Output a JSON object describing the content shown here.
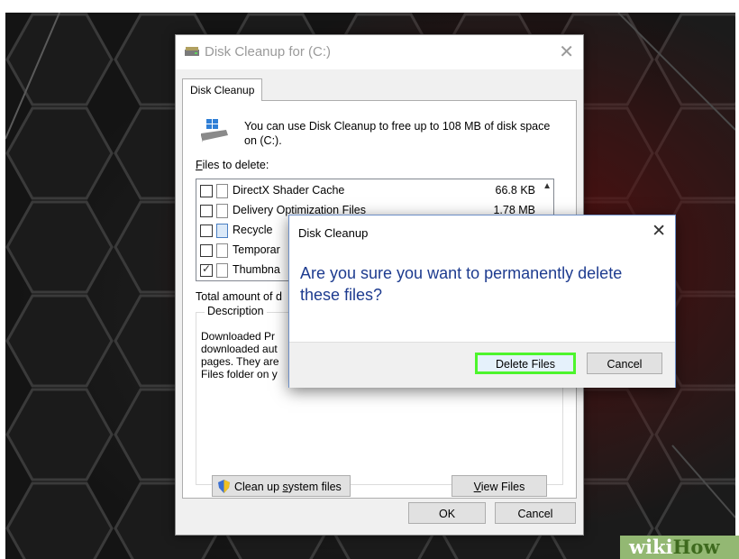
{
  "window": {
    "title": "Disk Cleanup for  (C:)",
    "tab_label": "Disk Cleanup",
    "intro_text": "You can use Disk Cleanup to free up to 108 MB of disk space on  (C:).",
    "files_label_prefix": "F",
    "files_label_rest": "iles to delete:",
    "files": [
      {
        "name": "DirectX Shader Cache",
        "size": "66.8 KB",
        "checked": false
      },
      {
        "name": "Delivery Optimization Files",
        "size": "1.78 MB",
        "checked": false
      },
      {
        "name": "Recycle",
        "size": "",
        "checked": false
      },
      {
        "name": "Temporar",
        "size": "",
        "checked": false
      },
      {
        "name": "Thumbna",
        "size": "",
        "checked": true
      }
    ],
    "total_label": "Total amount of d",
    "description_label": "Description",
    "description_text": [
      "Downloaded Pr",
      "downloaded aut",
      "pages. They are",
      "Files folder on y"
    ],
    "clean_system_label_pre": "Clean up ",
    "clean_system_label_u": "s",
    "clean_system_label_post": "ystem files",
    "view_files_label_u": "V",
    "view_files_label_post": "iew Files",
    "ok_label": "OK",
    "cancel_label": "Cancel"
  },
  "dialog": {
    "title": "Disk Cleanup",
    "message": "Are you sure you want to permanently delete these files?",
    "delete_label": "Delete Files",
    "cancel_label": "Cancel",
    "highlight_color": "#4df52c"
  },
  "watermark": {
    "part1": "wiki",
    "part2": "How"
  }
}
